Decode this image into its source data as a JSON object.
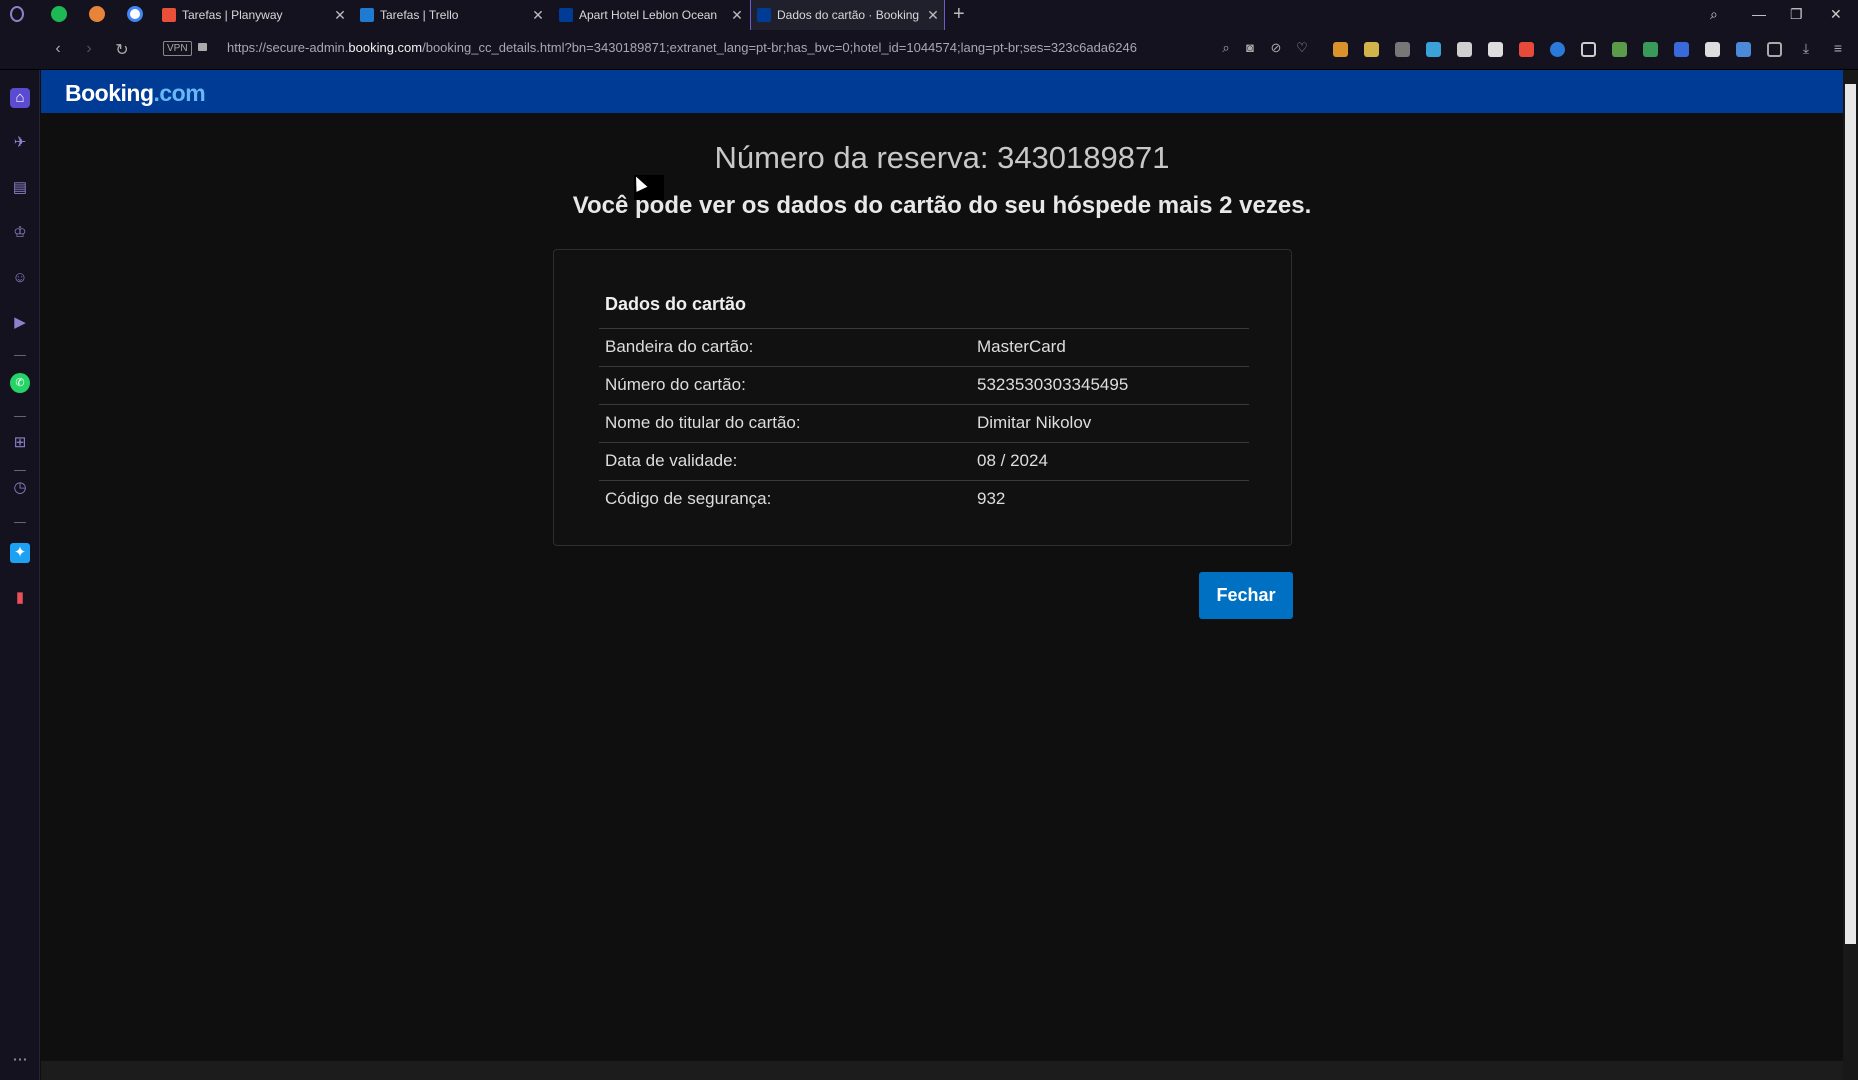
{
  "browser": {
    "tabs": [
      {
        "title": "Tarefas | Planyway",
        "favicon_color": "#e8503a"
      },
      {
        "title": "Tarefas | Trello",
        "favicon_color": "#1e7bd1"
      },
      {
        "title": "Apart Hotel Leblon Ocean",
        "favicon_color": "#003b95"
      },
      {
        "title": "Dados do cartão · Booking",
        "favicon_color": "#003b95"
      }
    ],
    "new_tab": "+",
    "vpn_label": "VPN",
    "url_prefix": "https://secure-admin.",
    "url_domain": "booking.com",
    "url_rest": "/booking_cc_details.html?bn=3430189871;extranet_lang=pt-br;has_bvc=0;hotel_id=1044574;lang=pt-br;ses=323c6ada6246"
  },
  "page": {
    "logo_main": "Booking",
    "logo_suffix": ".com",
    "reservation_heading": "Número da reserva: 3430189871",
    "view_warning": "Você pode ver os dados do cartão do seu hóspede mais 2 vezes.",
    "card_section_title": "Dados do cartão",
    "card_rows": [
      {
        "label": "Bandeira do cartão:",
        "value": "MasterCard"
      },
      {
        "label": "Número do cartão:",
        "value": "5323530303345495"
      },
      {
        "label": "Nome do titular do cartão:",
        "value": "Dimitar Nikolov"
      },
      {
        "label": "Data de validade:",
        "value": "08 / 2024"
      },
      {
        "label": "Código de segurança:",
        "value": "932"
      }
    ],
    "close_button": "Fechar"
  },
  "colors": {
    "header_blue": "#003b95",
    "button_blue": "#0071c2",
    "logo_accent": "#69b7f5"
  }
}
